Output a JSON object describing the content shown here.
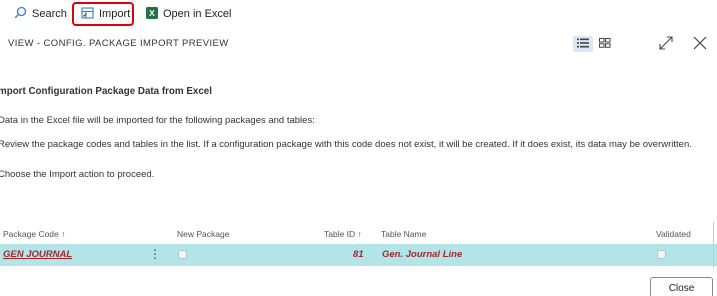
{
  "toolbar": {
    "search_label": "Search",
    "import_label": "Import",
    "open_excel_label": "Open in Excel"
  },
  "page": {
    "title": "VIEW - CONFIG. PACKAGE IMPORT PREVIEW"
  },
  "content": {
    "heading": "mport Configuration Package Data from Excel",
    "paragraph1": "Data in the Excel file will be imported for the following packages and tables:",
    "paragraph2": "Review the package codes and tables in the list. If a configuration package with this code does not exist, it will be created. If it does exist, its data may be overwritten.",
    "paragraph3": "Choose the Import action to proceed."
  },
  "grid": {
    "columns": {
      "package_code": "Package Code",
      "new_package": "New Package",
      "table_id": "Table ID",
      "table_name": "Table Name",
      "validated": "Validated"
    },
    "sort_arrow": "↑",
    "rows": [
      {
        "package_code": "GEN JOURNAL",
        "new_package": false,
        "table_id": "81",
        "table_name": "Gen. Journal Line",
        "validated": false
      }
    ]
  },
  "footer": {
    "close_label": "Close"
  },
  "colors": {
    "accent_red": "#e0000d",
    "row_highlight": "#b2e4e8",
    "link_red": "#a4262c",
    "excel_green": "#217346",
    "icon_blue": "#3a7bd5"
  },
  "icons": {
    "search": "search-icon",
    "import": "import-icon",
    "excel": "excel-icon",
    "list_view": "list-view-icon",
    "tile_view": "tile-view-icon",
    "expand": "expand-icon",
    "close": "close-icon",
    "row_actions": "more-actions-icon"
  }
}
